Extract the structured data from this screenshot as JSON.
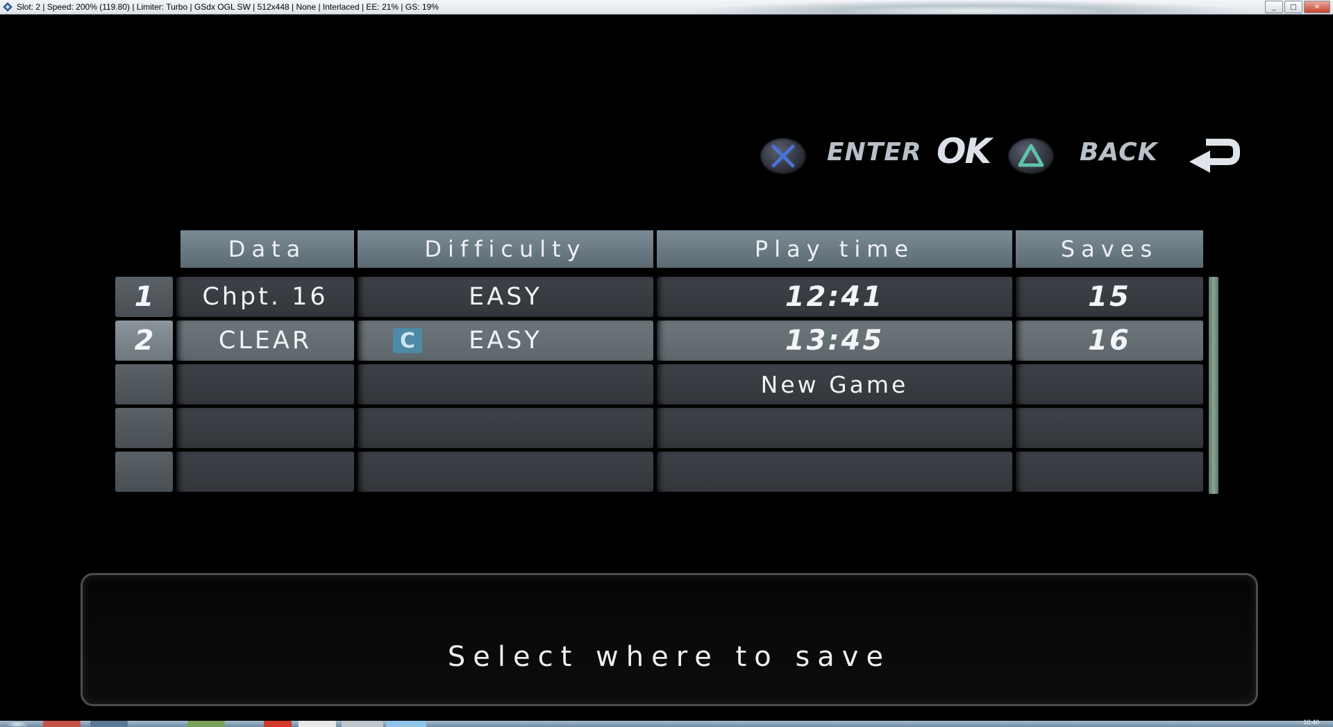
{
  "window": {
    "title": "Slot: 2 | Speed: 200% (119.80) | Limiter: Turbo | GSdx OGL SW | 512x448 | None | Interlaced | EE:  21% | GS:  19%",
    "minimize": "_",
    "maximize": "□",
    "close": "✕"
  },
  "hints": {
    "enter_label": "ENTER",
    "ok_label": "OK",
    "back_label": "BACK",
    "cross_color": "#4a72d8",
    "triangle_color": "#5ec4a8"
  },
  "table": {
    "headers": [
      "Data",
      "Difficulty",
      "Play time",
      "Saves"
    ],
    "rows": [
      {
        "num": "1",
        "data": "Chpt.  16",
        "difficulty": "EASY",
        "badge": "",
        "play_time": "12:41",
        "saves": "15",
        "selected": false
      },
      {
        "num": "2",
        "data": "CLEAR",
        "difficulty": "EASY",
        "badge": "C",
        "play_time": "13:45",
        "saves": "16",
        "selected": true
      },
      {
        "num": "",
        "data": "",
        "difficulty": "",
        "badge": "",
        "play_time": "New Game",
        "saves": "",
        "selected": false
      },
      {
        "num": "",
        "data": "",
        "difficulty": "",
        "badge": "",
        "play_time": "",
        "saves": "",
        "selected": false
      },
      {
        "num": "",
        "data": "",
        "difficulty": "",
        "badge": "",
        "play_time": "",
        "saves": "",
        "selected": false
      }
    ]
  },
  "message": "Select where to save",
  "taskbar": {
    "clock": "10:40"
  }
}
